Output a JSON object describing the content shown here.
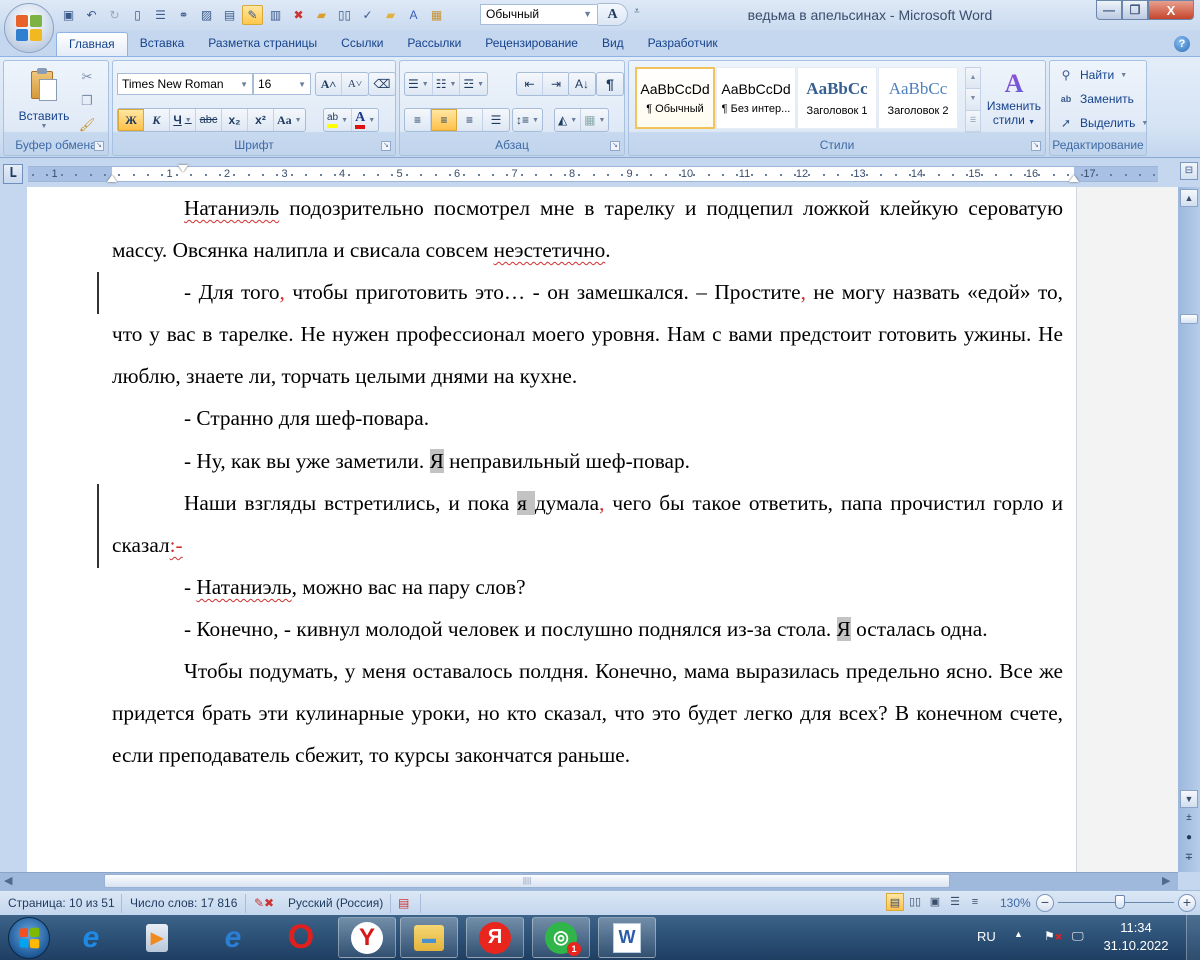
{
  "window": {
    "title": "ведьма в апельсинах - Microsoft Word",
    "minimize": "—",
    "maximize": "❐",
    "close": "X"
  },
  "quick_access": {
    "style_value": "Обычный",
    "font_button": "A",
    "icons": [
      "save-icon",
      "undo-icon",
      "redo-icon",
      "new-document-icon",
      "print-preview-icon",
      "hyperlink-icon",
      "insert-picture-icon",
      "page-icon",
      "edit-document-icon",
      "document-map-icon",
      "delete-icon",
      "open-folder-icon",
      "book-icon",
      "spelling-icon",
      "folder-icon",
      "font-color-icon",
      "paste-special-icon"
    ]
  },
  "tabs": [
    {
      "label": "Главная",
      "active": true
    },
    {
      "label": "Вставка"
    },
    {
      "label": "Разметка страницы"
    },
    {
      "label": "Ссылки"
    },
    {
      "label": "Рассылки"
    },
    {
      "label": "Рецензирование"
    },
    {
      "label": "Вид"
    },
    {
      "label": "Разработчик"
    }
  ],
  "ribbon": {
    "clipboard": {
      "label": "Буфер обмена",
      "paste": "Вставить"
    },
    "font": {
      "label": "Шрифт",
      "font_name": "Times New Roman",
      "font_size": "16",
      "grow": "A˄",
      "shrink": "A˅",
      "bold": "Ж",
      "italic": "К",
      "underline": "Ч",
      "strike": "abc",
      "subscript": "x₂",
      "superscript": "x²",
      "change_case": "Aa",
      "highlight": "ab",
      "font_color": "A",
      "highlight_color": "#ffff00",
      "font_color_value": "#e01010"
    },
    "paragraph": {
      "label": "Абзац",
      "pilcrow": "¶",
      "align_active": "center"
    },
    "styles": {
      "label": "Стили",
      "items": [
        {
          "sample": "AaBbCcDd",
          "name": "¶ Обычный",
          "selected": true
        },
        {
          "sample": "AaBbCcDd",
          "name": "¶ Без интер..."
        },
        {
          "sample": "AaBbCc",
          "name": "Заголовок 1"
        },
        {
          "sample": "AaBbCc",
          "name": "Заголовок 2"
        }
      ],
      "change_styles_line1": "Изменить",
      "change_styles_line2": "стили"
    },
    "editing": {
      "label": "Редактирование",
      "find": "Найти",
      "replace": "Заменить",
      "select": "Выделить"
    }
  },
  "ruler": {
    "tab_selector": "L",
    "numbers": [
      "1",
      "1",
      "2",
      "3",
      "4",
      "5",
      "6",
      "7",
      "8",
      "9",
      "10",
      "11",
      "12",
      "13",
      "14",
      "15",
      "16",
      "17"
    ]
  },
  "document": {
    "paragraphs": [
      {
        "indent": true,
        "parts": [
          {
            "t": "Натаниэль",
            "spell": true
          },
          {
            "t": " подозрительно посмотрел мне в тарелку и подцепил ложкой клейкую сероватую  массу. Овсянка налипла и свисала совсем "
          },
          {
            "t": "неэстетично",
            "spell": true
          },
          {
            "t": "."
          }
        ]
      },
      {
        "indent": true,
        "parts": [
          {
            "t": "- Для того"
          },
          {
            "t": ",",
            "red": true
          },
          {
            "t": " чтобы приготовить это… - он замешкался. – Простите"
          },
          {
            "t": ",",
            "red": true
          },
          {
            "t": " не могу назвать «едой» то, что у вас в тарелке. Не нужен профессионал моего уровня. Нам с вами предстоит готовить ужины. Не  люблю, знаете ли, торчать целыми днями на кухне."
          }
        ]
      },
      {
        "indent": true,
        "parts": [
          {
            "t": "- Странно для шеф-повара."
          }
        ]
      },
      {
        "indent": true,
        "parts": [
          {
            "t": "- Ну, как вы уже заметили. "
          },
          {
            "t": "Я",
            "hl": true
          },
          {
            "t": " неправильный шеф-повар."
          }
        ]
      },
      {
        "indent": true,
        "parts": [
          {
            "t": "Наши взгляды встретились, и пока "
          },
          {
            "t": " я ",
            "hl": true
          },
          {
            "t": "думала"
          },
          {
            "t": ",",
            "red": true
          },
          {
            "t": " чего бы такое ответить, папа прочистил горло и сказал"
          },
          {
            "t": ":-",
            "red": true,
            "spell": true
          }
        ]
      },
      {
        "indent": true,
        "parts": [
          {
            "t": "- "
          },
          {
            "t": "Натаниэль",
            "spell": true
          },
          {
            "t": ", можно вас на пару слов?"
          }
        ]
      },
      {
        "indent": true,
        "parts": [
          {
            "t": "- Конечно, - кивнул молодой человек и послушно поднялся из-за стола. "
          },
          {
            "t": "Я",
            "hl": true
          },
          {
            "t": " осталась одна."
          }
        ]
      },
      {
        "indent": true,
        "parts": [
          {
            "t": "Чтобы подумать, у меня оставалось полдня.  Конечно,  мама выразилась предельно ясно. Все же придется брать  эти кулинарные уроки, но кто сказал, что это будет легко для всех? В конечном счете, если преподаватель сбежит,  то курсы закончатся раньше."
          }
        ]
      }
    ]
  },
  "statusbar": {
    "page": "Страница: 10 из 51",
    "words": "Число слов: 17 816",
    "language": "Русский (Россия)",
    "zoom": "130%",
    "zoom_percent": 130
  },
  "taskbar": {
    "apps": [
      {
        "name": "internet-explorer-edge",
        "glyph": "e",
        "color": "#1e8ae6"
      },
      {
        "name": "media-player",
        "glyph": "▶",
        "color": "#f08a1c"
      },
      {
        "name": "internet-explorer",
        "glyph": "e",
        "color": "#2a7fd4"
      },
      {
        "name": "opera",
        "glyph": "O",
        "color": "#e0201c"
      },
      {
        "name": "yandex-browser",
        "glyph": "Y",
        "color": "#d81818"
      },
      {
        "name": "file-explorer",
        "glyph": "▬",
        "color": "#f0c54a"
      },
      {
        "name": "yandex",
        "glyph": "Я",
        "color": "#ffffff"
      },
      {
        "name": "messenger",
        "glyph": "◎",
        "color": "#2fb54a",
        "badge": "1"
      },
      {
        "name": "microsoft-word",
        "glyph": "W",
        "color": "#2a5caa"
      }
    ],
    "language": "RU",
    "time": "11:34",
    "date": "31.10.2022"
  }
}
